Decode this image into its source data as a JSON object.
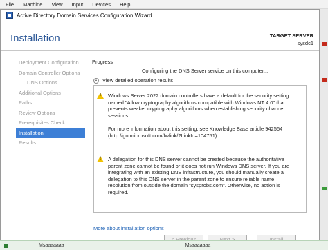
{
  "host_menu": [
    "File",
    "Machine",
    "View",
    "Input",
    "Devices",
    "Help"
  ],
  "window": {
    "title": "Active Directory Domain Services Configuration Wizard",
    "page_title": "Installation",
    "target_label": "TARGET SERVER",
    "target_value": "sysdc1"
  },
  "nav": [
    {
      "label": "Deployment Configuration",
      "active": false,
      "indent": false
    },
    {
      "label": "Domain Controller Options",
      "active": false,
      "indent": false
    },
    {
      "label": "DNS Options",
      "active": false,
      "indent": true
    },
    {
      "label": "Additional Options",
      "active": false,
      "indent": false
    },
    {
      "label": "Paths",
      "active": false,
      "indent": false
    },
    {
      "label": "Review Options",
      "active": false,
      "indent": false
    },
    {
      "label": "Prerequisites Check",
      "active": false,
      "indent": false
    },
    {
      "label": "Installation",
      "active": true,
      "indent": false
    },
    {
      "label": "Results",
      "active": false,
      "indent": false
    }
  ],
  "progress": {
    "label": "Progress",
    "status": "Configuring the DNS Server service on this computer...",
    "details_toggle": "View detailed operation results",
    "warnings": [
      "Windows Server 2022 domain controllers have a default for the security setting named \"Allow cryptography algorithms compatible with Windows NT 4.0\" that prevents weaker cryptography algorithms when establishing security channel sessions.\n\nFor more information about this setting, see Knowledge Base article 942564 (http://go.microsoft.com/fwlink/?LinkId=104751).",
      "A delegation for this DNS server cannot be created because the authoritative parent zone cannot be found or it does not run Windows DNS server. If you are integrating with an existing DNS infrastructure, you should manually create a delegation to this DNS server in the parent zone to ensure reliable name resolution from outside the domain \"sysprobs.com\". Otherwise, no action is required."
    ],
    "more_link": "More about installation options"
  },
  "buttons": {
    "previous": "< Previous",
    "next": "Next >",
    "install": "Install"
  },
  "host_bottom": {
    "left_text": "Msaaaaaaa",
    "right_text": "Msaaaaaaa"
  },
  "colors": {
    "accent": "#3d7fd6",
    "title_blue": "#2b5797",
    "link": "#1a5fb4",
    "warning": "#f2c200"
  }
}
